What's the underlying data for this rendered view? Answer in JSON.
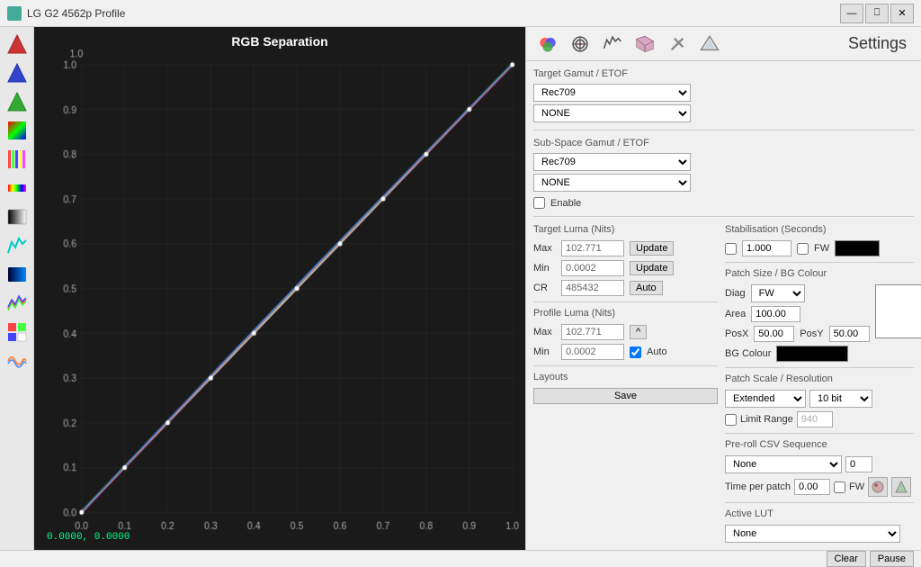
{
  "titleBar": {
    "title": "LG G2 4562p Profile",
    "icon": "monitor-icon"
  },
  "toolbar": {
    "icons": [
      {
        "name": "color-target-icon",
        "label": "Color Target"
      },
      {
        "name": "camera-icon",
        "label": "Camera"
      },
      {
        "name": "pattern-icon",
        "label": "Pattern"
      },
      {
        "name": "cube-icon",
        "label": "3D Cube"
      },
      {
        "name": "settings-icon",
        "label": "Settings"
      },
      {
        "name": "gamut-icon",
        "label": "Gamut"
      }
    ]
  },
  "sidebar": {
    "icons": [
      "triangle-red-icon",
      "triangle-blue-icon",
      "triangle-green-icon",
      "rgb-gradient-icon",
      "color-bars-icon",
      "rainbow-icon",
      "gray-ramp-icon",
      "cyan-icon",
      "blue-ramp-icon",
      "multicolor-icon",
      "pattern2-icon",
      "wave-icon"
    ]
  },
  "chart": {
    "title": "RGB Separation",
    "xMin": "0.0",
    "xMax": "1.0",
    "yMin": "0.0",
    "yMax": "1.0",
    "coords": "0.0000, 0.0000"
  },
  "settings": {
    "title": "Settings",
    "targetGamutLabel": "Target Gamut / ETOF",
    "targetGamutValue": "Rec709",
    "targetGamutSub": "NONE",
    "subSpaceLabel": "Sub-Space  Gamut / ETOF",
    "subSpaceValue": "Rec709",
    "subSpaceSub": "NONE",
    "enableLabel": "Enable",
    "targetLumaLabel": "Target Luma (Nits)",
    "maxLabel": "Max",
    "maxValue": "102.771",
    "minLabel": "Min",
    "minValue": "0.0002",
    "crLabel": "CR",
    "crValue": "485432",
    "profileLumaLabel": "Profile Luma (Nits)",
    "profileMaxValue": "102.771",
    "profileMinValue": "0.0002",
    "updateLabel": "Update",
    "autoLabel": "Auto",
    "layoutsLabel": "Layouts",
    "saveLabel": "Save",
    "stabilisationLabel": "Stabilisation (Seconds)",
    "stabValue": "1.000",
    "stabFwLabel": "FW",
    "patchSizeLabel": "Patch Size / BG Colour",
    "diagLabel": "Diag",
    "fwLabel": "FW",
    "areaLabel": "Area",
    "areaValue": "100.00",
    "posXLabel": "PosX",
    "posXValue": "50.00",
    "posYLabel": "PosY",
    "posYValue": "50.00",
    "bgColourLabel": "BG Colour",
    "patchScaleLabel": "Patch Scale / Resolution",
    "extendedLabel": "Extended",
    "bitLabel": "10 bit",
    "limitRangeLabel": "Limit Range",
    "limitRangeValue": "940",
    "preRollLabel": "Pre-roll CSV Sequence",
    "preRollValue": "None",
    "preRollNum": "0",
    "timePatchLabel": "Time per patch",
    "timePatchValue": "0.00",
    "timePatchFwLabel": "FW",
    "activeLutLabel": "Active LUT",
    "activeLutValue": "None",
    "clearLabel": "Clear",
    "pauseLabel": "Pause"
  }
}
